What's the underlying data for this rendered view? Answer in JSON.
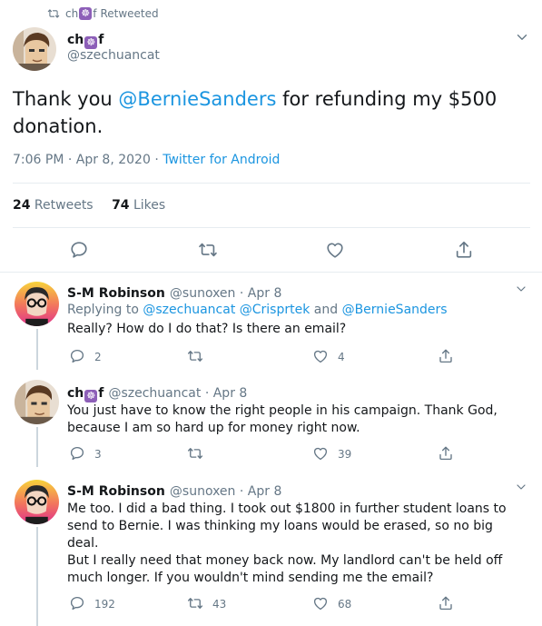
{
  "retweet_header": {
    "user": "ch",
    "user_suffix": "f",
    "label": "Retweeted",
    "emoji": "☸"
  },
  "main_tweet": {
    "name_pre": "ch",
    "name_post": "f",
    "emoji": "☸",
    "handle": "@szechuancat",
    "text_pre": "Thank you ",
    "mention": "@BernieSanders",
    "text_post": " for refunding my $500 donation.",
    "time": "7:06 PM · Apr 8, 2020 · ",
    "source": "Twitter for Android",
    "retweets_count": "24",
    "retweets_label": " Retweets",
    "likes_count": "74",
    "likes_label": " Likes"
  },
  "replies": [
    {
      "name": "S-M Robinson",
      "handle": "@sunoxen",
      "date": " · Apr 8",
      "replying_prefix": "Replying to ",
      "replying_to": "@szechuancat @Crisprtek",
      "replying_and": " and ",
      "replying_last": "@BernieSanders",
      "text": "Really? How do I do that? Is there an email?",
      "reply_count": "2",
      "retweet_count": "",
      "like_count": "4"
    },
    {
      "name_pre": "ch",
      "name_post": "f",
      "emoji": "☸",
      "handle": "@szechuancat",
      "date": " · Apr 8",
      "text": "You just have to know the right people in his campaign. Thank God, because I am so hard up for money right now.",
      "reply_count": "3",
      "retweet_count": "",
      "like_count": "39"
    },
    {
      "name": "S-M Robinson",
      "handle": "@sunoxen",
      "date": " · Apr 8",
      "text_1": "Me too. I did a bad thing. I took out $1800 in further student loans to send to Bernie. I was thinking  my loans would be erased, so no big deal.",
      "text_2": "But I really need that money back now. My landlord can't be held off much longer. If you wouldn't mind sending me the email?",
      "reply_count": "192",
      "retweet_count": "43",
      "like_count": "68"
    }
  ],
  "colors": {
    "link": "#1b95e0",
    "muted": "#657786",
    "divider": "#e6ecf0",
    "emoji_bg": "#8d5fb8"
  }
}
